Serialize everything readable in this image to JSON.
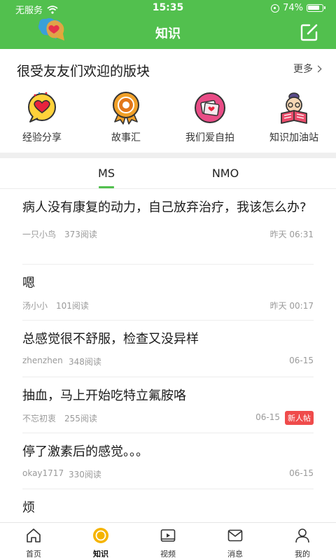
{
  "status": {
    "carrier": "无服务",
    "time": "15:35",
    "battery": "74%"
  },
  "nav": {
    "title": "知识"
  },
  "boards_section": {
    "title": "很受友友们欢迎的版块",
    "more": "更多",
    "items": [
      {
        "label": "经验分享",
        "icon": "heart-chat-icon"
      },
      {
        "label": "故事汇",
        "icon": "medal-icon"
      },
      {
        "label": "我们爱自拍",
        "icon": "photo-heart-icon"
      },
      {
        "label": "知识加油站",
        "icon": "reader-icon"
      }
    ]
  },
  "tabs": [
    {
      "label": "MS",
      "active": true
    },
    {
      "label": "NMO",
      "active": false
    }
  ],
  "posts": [
    {
      "title": "病人没有康复的动力，自己放弃治疗，我该怎么办?",
      "author": "一只小鸟",
      "reads": "373阅读",
      "time": "昨天 06:31"
    },
    {
      "title": "嗯",
      "author": "汤小小",
      "reads": "101阅读",
      "time": "昨天 00:17"
    },
    {
      "title": "总感觉很不舒服，检查又没异样",
      "author": "zhenzhen",
      "reads": "348阅读",
      "time": "06-15"
    },
    {
      "title": "抽血，马上开始吃特立氟胺咯",
      "author": "不忘初衷",
      "reads": "255阅读",
      "time": "06-15",
      "badge": "新人帖"
    },
    {
      "title": "停了激素后的感觉。。。",
      "author": "okay1717",
      "reads": "330阅读",
      "time": "06-15"
    },
    {
      "title": "烦",
      "author": "",
      "reads": "",
      "time": ""
    }
  ],
  "tabbar": [
    {
      "label": "首页",
      "icon": "home-icon"
    },
    {
      "label": "知识",
      "icon": "knowledge-icon",
      "active": true
    },
    {
      "label": "视频",
      "icon": "video-icon"
    },
    {
      "label": "消息",
      "icon": "message-icon"
    },
    {
      "label": "我的",
      "icon": "profile-icon"
    }
  ],
  "colors": {
    "brand": "#52c04e",
    "badge": "#ef4b4b"
  }
}
